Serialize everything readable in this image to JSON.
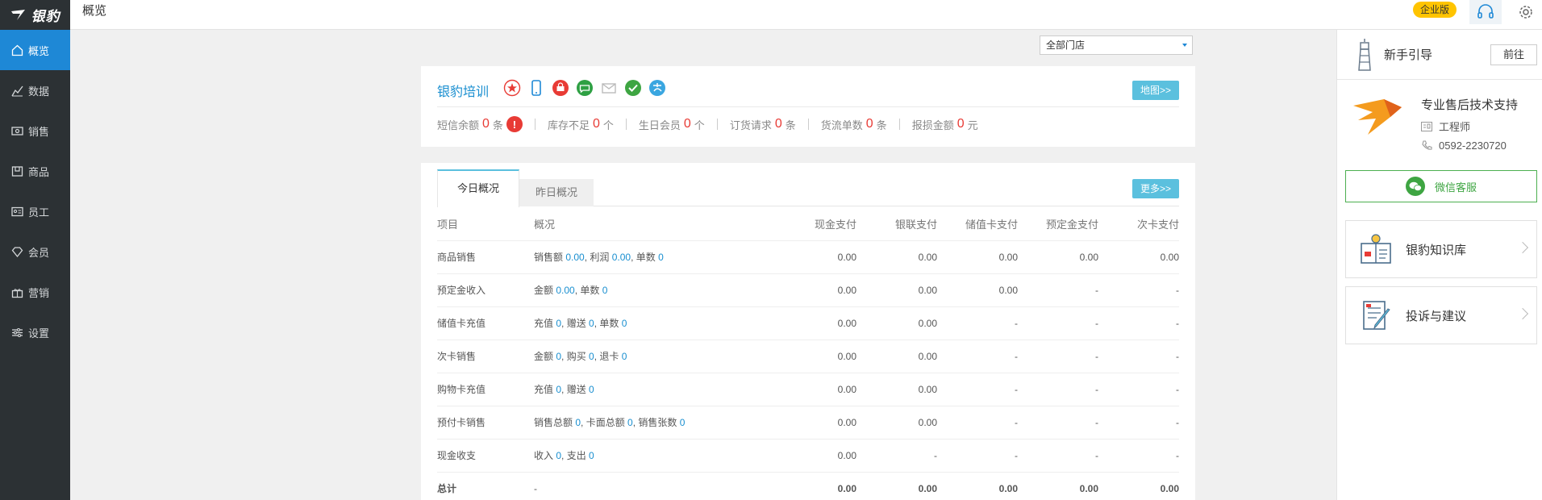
{
  "app": {
    "logo_text": "银豹",
    "page_title": "概览",
    "edition_badge": "企业版",
    "icons": {
      "headset": "headset-icon",
      "gear": "gear-icon"
    }
  },
  "sidebar": {
    "items": [
      {
        "label": "概览",
        "icon": "home-icon",
        "active": true
      },
      {
        "label": "数据",
        "icon": "chart-line-icon",
        "active": false
      },
      {
        "label": "销售",
        "icon": "cash-icon",
        "active": false
      },
      {
        "label": "商品",
        "icon": "box-icon",
        "active": false
      },
      {
        "label": "员工",
        "icon": "id-card-icon",
        "active": false
      },
      {
        "label": "会员",
        "icon": "diamond-icon",
        "active": false
      },
      {
        "label": "营销",
        "icon": "gift-icon",
        "active": false
      },
      {
        "label": "设置",
        "icon": "sliders-icon",
        "active": false
      }
    ]
  },
  "filter": {
    "store_select": "全部门店"
  },
  "store": {
    "name": "银豹培训",
    "map_button": "地图>>",
    "stats": [
      {
        "label": "短信余额",
        "value": "0",
        "unit": "条"
      },
      {
        "label": "库存不足",
        "value": "0",
        "unit": "个"
      },
      {
        "label": "生日会员",
        "value": "0",
        "unit": "个"
      },
      {
        "label": "订货请求",
        "value": "0",
        "unit": "条"
      },
      {
        "label": "货流单数",
        "value": "0",
        "unit": "条"
      },
      {
        "label": "报损金额",
        "value": "0",
        "unit": "元"
      }
    ]
  },
  "summary": {
    "tab_today": "今日概况",
    "tab_yesterday": "昨日概况",
    "more_button": "更多>>",
    "columns": [
      "项目",
      "概况",
      "现金支付",
      "银联支付",
      "储值卡支付",
      "预定金支付",
      "次卡支付"
    ],
    "rows": [
      {
        "item": "商品销售",
        "overview": [
          [
            "销售额 ",
            "0.00"
          ],
          [
            ", 利润 ",
            "0.00"
          ],
          [
            ", 单数 ",
            "0"
          ]
        ],
        "values": [
          "0.00",
          "0.00",
          "0.00",
          "0.00",
          "0.00"
        ]
      },
      {
        "item": "预定金收入",
        "overview": [
          [
            "金额 ",
            "0.00"
          ],
          [
            ", 单数 ",
            "0"
          ]
        ],
        "values": [
          "0.00",
          "0.00",
          "0.00",
          "-",
          "-"
        ]
      },
      {
        "item": "储值卡充值",
        "overview": [
          [
            "充值 ",
            "0"
          ],
          [
            ", 赠送 ",
            "0"
          ],
          [
            ", 单数 ",
            "0"
          ]
        ],
        "values": [
          "0.00",
          "0.00",
          "-",
          "-",
          "-"
        ]
      },
      {
        "item": "次卡销售",
        "overview": [
          [
            "金额 ",
            "0"
          ],
          [
            ", 购买 ",
            "0"
          ],
          [
            ", 退卡 ",
            "0"
          ]
        ],
        "values": [
          "0.00",
          "0.00",
          "-",
          "-",
          "-"
        ]
      },
      {
        "item": "购物卡充值",
        "overview": [
          [
            "充值 ",
            "0"
          ],
          [
            ", 赠送 ",
            "0"
          ]
        ],
        "values": [
          "0.00",
          "0.00",
          "-",
          "-",
          "-"
        ]
      },
      {
        "item": "预付卡销售",
        "overview": [
          [
            "销售总额 ",
            "0"
          ],
          [
            ", 卡面总额 ",
            "0"
          ],
          [
            ", 销售张数 ",
            "0"
          ]
        ],
        "values": [
          "0.00",
          "0.00",
          "-",
          "-",
          "-"
        ]
      },
      {
        "item": "现金收支",
        "overview": [
          [
            "收入 ",
            "0"
          ],
          [
            ", 支出 ",
            "0"
          ]
        ],
        "values": [
          "0.00",
          "-",
          "-",
          "-",
          "-"
        ],
        "plain_values": true
      },
      {
        "item": "总计",
        "overview_text": "-",
        "values": [
          "0.00",
          "0.00",
          "0.00",
          "0.00",
          "0.00"
        ],
        "total": true
      }
    ]
  },
  "right_panel": {
    "guide_title": "新手引导",
    "goto_button": "前往",
    "support_title": "专业售后技术支持",
    "support_role": "工程师",
    "support_phone": "0592-2230720",
    "wechat_button": "微信客服",
    "knowledge_base": "银豹知识库",
    "feedback": "投诉与建议"
  }
}
